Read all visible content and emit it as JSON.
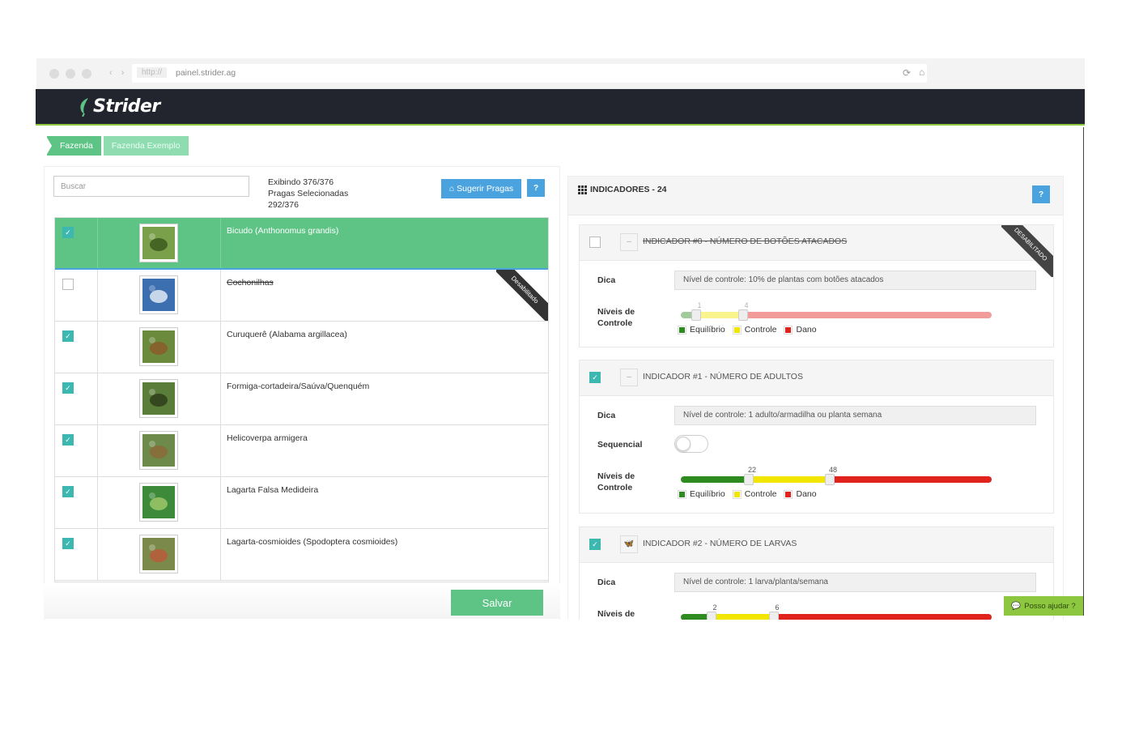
{
  "browser": {
    "protocol": "http://",
    "url": "painel.strider.ag"
  },
  "app": {
    "brand": "Strider",
    "brand_color": "#22252e",
    "accent_color": "#5ec486",
    "blue_color": "#4aa3df"
  },
  "breadcrumb": [
    {
      "label": "Fazenda"
    },
    {
      "label": "Fazenda Exemplo"
    }
  ],
  "left": {
    "search_placeholder": "Buscar",
    "stats_line1": "Exibindo 376/376",
    "stats_line2": "Pragas Selecionadas",
    "stats_line3": "292/376",
    "sugerir_label": "Sugerir Pragas",
    "help_label": "?",
    "save_label": "Salvar",
    "pests": [
      {
        "name": "Bicudo (Anthonomus grandis)",
        "checked": true,
        "selected": true,
        "disabled": false,
        "ribbon": "",
        "icon": "cotton-boll-pest-photo"
      },
      {
        "name": "Cochonilhas",
        "checked": false,
        "selected": false,
        "disabled": true,
        "ribbon": "Desabilitado",
        "icon": "mealybug-photo"
      },
      {
        "name": "Curuquerê (Alabama argillacea)",
        "checked": true,
        "selected": false,
        "disabled": false,
        "ribbon": "",
        "icon": "caterpillar-photo"
      },
      {
        "name": "Formiga-cortadeira/Saúva/Quenquém",
        "checked": true,
        "selected": false,
        "disabled": false,
        "ribbon": "",
        "icon": "ant-photo"
      },
      {
        "name": "Helicoverpa armigera",
        "checked": true,
        "selected": false,
        "disabled": false,
        "ribbon": "",
        "icon": "helicoverpa-photo"
      },
      {
        "name": "Lagarta Falsa Medideira",
        "checked": true,
        "selected": false,
        "disabled": false,
        "ribbon": "",
        "icon": "looper-photo"
      },
      {
        "name": "Lagarta-cosmioides (Spodoptera cosmioides)",
        "checked": true,
        "selected": false,
        "disabled": false,
        "ribbon": "",
        "icon": "spodoptera-photo"
      }
    ]
  },
  "right": {
    "title": "INDICADORES - 24",
    "help_label": "?",
    "dica_label": "Dica",
    "niveis_label_1": "Níveis de",
    "niveis_label_2": "Controle",
    "sequencial_label": "Sequencial",
    "legend": [
      {
        "label": "Equilíbrio",
        "color": "#2e8b1f"
      },
      {
        "label": "Controle",
        "color": "#f2e600"
      },
      {
        "label": "Dano",
        "color": "#e0231d"
      }
    ],
    "indicators": [
      {
        "title": "INDICADOR #0 - NÚMERO DE BOTÕES ATACADOS",
        "checked": false,
        "disabled": true,
        "ribbon": "DESABILITADO",
        "dica": "Nível de controle: 10% de plantas com botões atacados",
        "low": 1,
        "high": 4,
        "icon_text": "–"
      },
      {
        "title": "INDICADOR #1 - NÚMERO DE ADULTOS",
        "checked": true,
        "disabled": false,
        "ribbon": "",
        "dica": "Nível de controle: 1 adulto/armadilha ou planta semana",
        "low": 22,
        "high": 48,
        "icon_text": "–"
      },
      {
        "title": "INDICADOR #2 - NÚMERO DE LARVAS",
        "checked": true,
        "disabled": false,
        "ribbon": "",
        "dica": "Nível de controle: 1 larva/planta/semana",
        "low": 2,
        "high": 6,
        "icon_text": "🦋"
      }
    ]
  },
  "chat": {
    "label": "Posso ajudar ?"
  }
}
